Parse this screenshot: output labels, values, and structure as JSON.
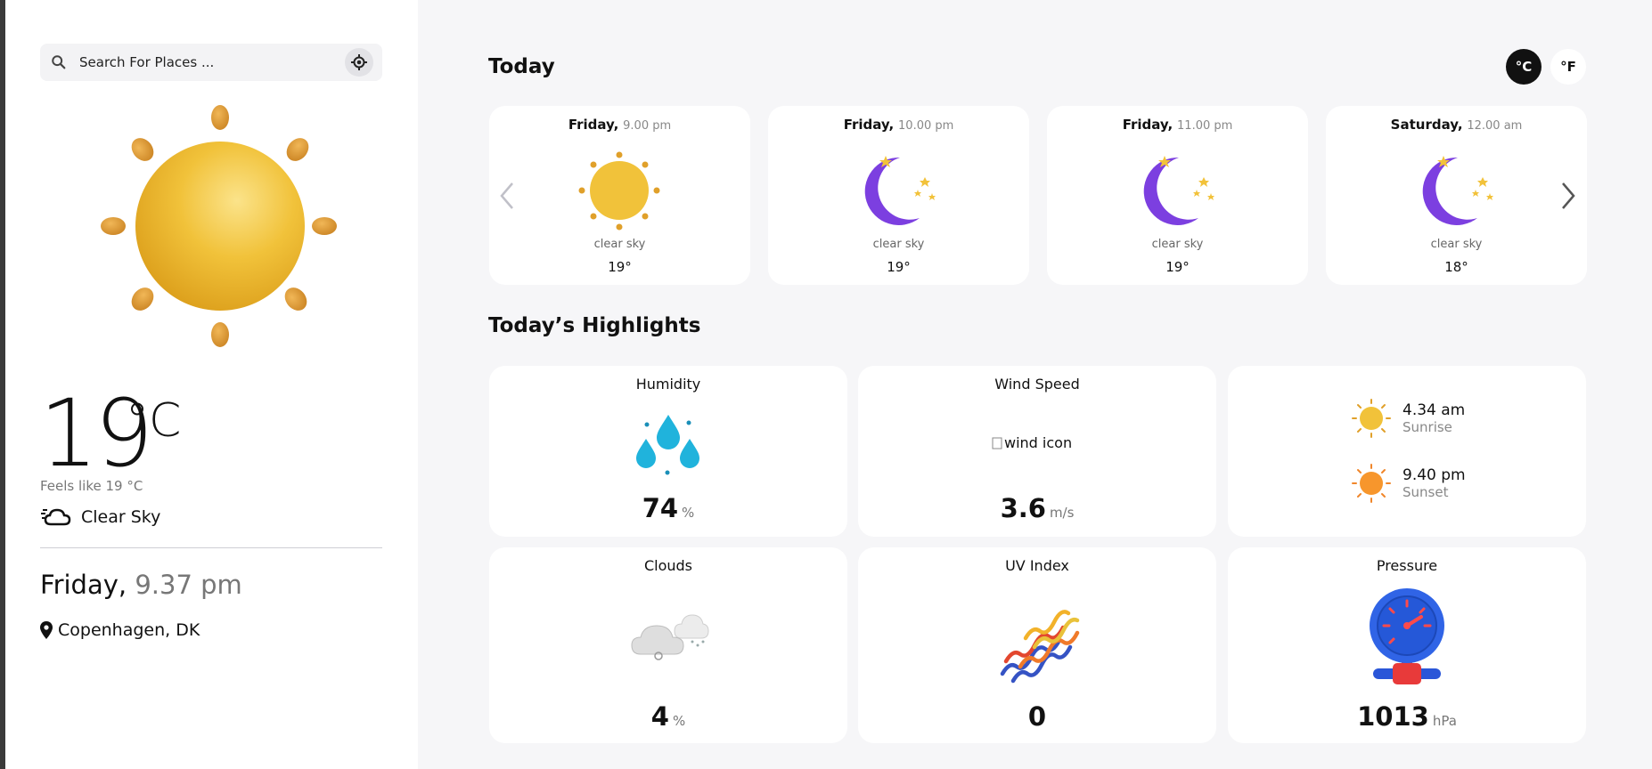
{
  "search": {
    "placeholder": "Search For Places ..."
  },
  "current": {
    "temperature": "19",
    "unit": "°C",
    "feels_like": "Feels like 19 °C",
    "condition": "Clear Sky",
    "day": "Friday,",
    "time": "9.37 pm",
    "location": "Copenhagen, DK"
  },
  "units": {
    "celsius": "°C",
    "fahrenheit": "°F",
    "active": "celsius"
  },
  "today": {
    "title": "Today",
    "forecast": [
      {
        "day": "Friday,",
        "time": "9.00 pm",
        "icon": "sun-icon",
        "desc": "clear sky",
        "temp": "19°"
      },
      {
        "day": "Friday,",
        "time": "10.00 pm",
        "icon": "moon-icon",
        "desc": "clear sky",
        "temp": "19°"
      },
      {
        "day": "Friday,",
        "time": "11.00 pm",
        "icon": "moon-icon",
        "desc": "clear sky",
        "temp": "19°"
      },
      {
        "day": "Saturday,",
        "time": "12.00 am",
        "icon": "moon-icon",
        "desc": "clear sky",
        "temp": "18°"
      }
    ]
  },
  "highlights": {
    "title": "Today’s Highlights",
    "humidity": {
      "label": "Humidity",
      "value": "74",
      "unit": "%"
    },
    "wind": {
      "label": "Wind Speed",
      "value": "3.6",
      "unit": "m/s",
      "alt": "wind icon"
    },
    "sun": {
      "sunrise_time": "4.34 am",
      "sunrise_label": "Sunrise",
      "sunset_time": "9.40 pm",
      "sunset_label": "Sunset"
    },
    "clouds": {
      "label": "Clouds",
      "value": "4",
      "unit": "%"
    },
    "uv": {
      "label": "UV Index",
      "value": "0"
    },
    "pressure": {
      "label": "Pressure",
      "value": "1013",
      "unit": "hPa"
    }
  },
  "colors": {
    "sun": "#f0c030",
    "moon": "#7c3fe0",
    "active_unit_bg": "#111111",
    "panel_bg": "#f6f6f8"
  }
}
